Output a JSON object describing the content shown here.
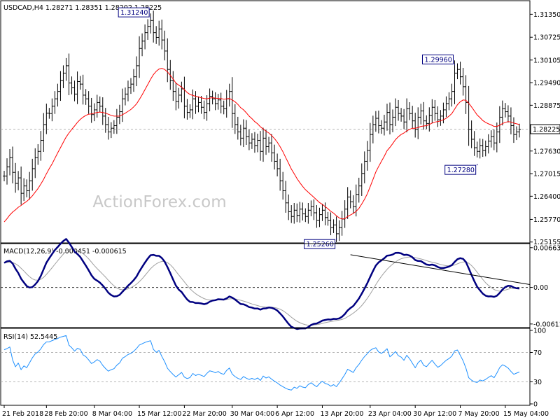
{
  "chart_data": {
    "type": "ohlc",
    "symbol_header": "USDCAD,H4  1.28271 1.28351 1.28202 1.28225",
    "watermark": "ActionForex.com",
    "price_panel": {
      "ylim": [
        1.2515,
        1.317
      ],
      "ticks": [
        "1.31350",
        "1.30725",
        "1.30105",
        "1.29490",
        "1.28875",
        "1.28225",
        "1.27630",
        "1.27015",
        "1.26400",
        "1.25770",
        "1.25155"
      ],
      "last_price": "1.28225",
      "annotations": [
        {
          "label": "1.31240",
          "bar": 52,
          "value": 1.3124
        },
        {
          "label": "1.25260",
          "bar": 118,
          "value": 1.2526
        },
        {
          "label": "1.29960",
          "bar": 160,
          "value": 1.2996
        },
        {
          "label": "1.27280",
          "bar": 168,
          "value": 1.2728
        }
      ],
      "close": [
        1.2695,
        1.272,
        1.2745,
        1.2705,
        1.2675,
        1.269,
        1.2648,
        1.2668,
        1.2655,
        1.2682,
        1.2715,
        1.2745,
        1.2762,
        1.2792,
        1.2835,
        1.2866,
        1.2865,
        1.2885,
        1.2905,
        1.2925,
        1.2955,
        1.2975,
        1.2995,
        1.2948,
        1.2935,
        1.2918,
        1.2952,
        1.2945,
        1.2915,
        1.2905,
        1.2885,
        1.2862,
        1.2875,
        1.2895,
        1.2885,
        1.2858,
        1.2835,
        1.2815,
        1.2825,
        1.2832,
        1.2855,
        1.287,
        1.2905,
        1.2918,
        1.2935,
        1.2945,
        1.2965,
        1.2995,
        1.3042,
        1.3062,
        1.3085,
        1.3102,
        1.3118,
        1.3085,
        1.3072,
        1.3095,
        1.3065,
        1.3035,
        1.2985,
        1.2955,
        1.2925,
        1.2898,
        1.2915,
        1.2932,
        1.2885,
        1.2868,
        1.2875,
        1.2905,
        1.2885,
        1.2895,
        1.2882,
        1.2868,
        1.2892,
        1.2912,
        1.2905,
        1.2892,
        1.2902,
        1.2885,
        1.2878,
        1.2905,
        1.2925,
        1.2865,
        1.2835,
        1.2815,
        1.2798,
        1.2825,
        1.2802,
        1.2785,
        1.2795,
        1.2778,
        1.2792,
        1.2762,
        1.2798,
        1.2775,
        1.2785,
        1.2758,
        1.2735,
        1.2715,
        1.2682,
        1.2655,
        1.2622,
        1.2598,
        1.2585,
        1.2602,
        1.2588,
        1.2605,
        1.2592,
        1.2585,
        1.2602,
        1.2612,
        1.2595,
        1.2575,
        1.259,
        1.2602,
        1.2582,
        1.2575,
        1.2555,
        1.2562,
        1.2538,
        1.2555,
        1.2578,
        1.2605,
        1.2638,
        1.2625,
        1.2612,
        1.2645,
        1.2668,
        1.2702,
        1.2735,
        1.2765,
        1.2808,
        1.2835,
        1.2852,
        1.2832,
        1.2825,
        1.2842,
        1.2868,
        1.2835,
        1.2855,
        1.2882,
        1.2865,
        1.2858,
        1.2842,
        1.2878,
        1.2865,
        1.2845,
        1.2822,
        1.2855,
        1.2872,
        1.2845,
        1.2838,
        1.286,
        1.2882,
        1.2865,
        1.2848,
        1.2858,
        1.2875,
        1.2892,
        1.2905,
        1.2925,
        1.2975,
        1.2985,
        1.2965,
        1.2938,
        1.2895,
        1.2822,
        1.2795,
        1.2772,
        1.2762,
        1.2778,
        1.2765,
        1.2775,
        1.279,
        1.2802,
        1.2785,
        1.2815,
        1.2855,
        1.2878,
        1.287,
        1.2858,
        1.2832,
        1.2808,
        1.2815,
        1.2822
      ],
      "ma_close": [
        1.257,
        1.2579,
        1.2589,
        1.2597,
        1.2603,
        1.261,
        1.2615,
        1.2621,
        1.2626,
        1.2633,
        1.2641,
        1.2651,
        1.2661,
        1.2673,
        1.2686,
        1.2701,
        1.2715,
        1.2728,
        1.2743,
        1.2758,
        1.2772,
        1.2787,
        1.2801,
        1.2812,
        1.2822,
        1.2831,
        1.2841,
        1.2849,
        1.2855,
        1.286,
        1.2863,
        1.2864,
        1.2866,
        1.2868,
        1.2869,
        1.2868,
        1.2866,
        1.2863,
        1.286,
        1.2858,
        1.2858,
        1.2858,
        1.2862,
        1.2866,
        1.2871,
        1.2876,
        1.2883,
        1.2891,
        1.2903,
        1.2916,
        1.293,
        1.2944,
        1.2958,
        1.2971,
        1.298,
        1.2986,
        1.2988,
        1.2985,
        1.2978,
        1.2969,
        1.2959,
        1.2948,
        1.2942,
        1.2937,
        1.293,
        1.2922,
        1.2917,
        1.2914,
        1.2912,
        1.291,
        1.2908,
        1.2906,
        1.2905,
        1.2907,
        1.2908,
        1.2907,
        1.2906,
        1.2906,
        1.2904,
        1.2905,
        1.2906,
        1.2902,
        1.2897,
        1.289,
        1.2881,
        1.2875,
        1.2867,
        1.2858,
        1.2851,
        1.2843,
        1.2837,
        1.2829,
        1.2823,
        1.2817,
        1.2812,
        1.2805,
        1.2797,
        1.2787,
        1.2775,
        1.2761,
        1.2745,
        1.273,
        1.2714,
        1.2701,
        1.2688,
        1.2677,
        1.2667,
        1.2658,
        1.2651,
        1.2644,
        1.2637,
        1.263,
        1.2623,
        1.2618,
        1.2612,
        1.2606,
        1.2599,
        1.2594,
        1.2587,
        1.2581,
        1.2578,
        1.2579,
        1.2585,
        1.2589,
        1.2593,
        1.2599,
        1.2607,
        1.2619,
        1.2632,
        1.2647,
        1.2666,
        1.2686,
        1.2706,
        1.2721,
        1.2735,
        1.2749,
        1.2764,
        1.2773,
        1.2783,
        1.2794,
        1.2802,
        1.2808,
        1.2812,
        1.2818,
        1.2822,
        1.2825,
        1.2825,
        1.2827,
        1.283,
        1.2831,
        1.2832,
        1.2835,
        1.2839,
        1.2842,
        1.2843,
        1.2845,
        1.2848,
        1.2852,
        1.2858,
        1.2865,
        1.2877,
        1.2889,
        1.2897,
        1.2902,
        1.2901,
        1.2893,
        1.2883,
        1.2872,
        1.2861,
        1.2854,
        1.2846,
        1.2841,
        1.2837,
        1.2834,
        1.283,
        1.283,
        1.2833,
        1.2838,
        1.2841,
        1.2843,
        1.2842,
        1.2839,
        1.2837,
        1.2835
      ]
    },
    "macd_panel": {
      "label": "MACD(12,26,9) -0.000451 -0.000615",
      "ylim": [
        -0.0066,
        0.0072
      ],
      "ticks": [
        "0.006639",
        "0.00",
        "-0.006114"
      ],
      "main": [
        0.00409,
        0.00436,
        0.00444,
        0.00398,
        0.00312,
        0.0024,
        0.00146,
        0.00082,
        0.00022,
        -3e-05,
        4e-05,
        0.00047,
        0.00106,
        0.00191,
        0.00303,
        0.00413,
        0.00487,
        0.00558,
        0.00624,
        0.00674,
        0.00728,
        0.00775,
        0.00809,
        0.00748,
        0.00676,
        0.00598,
        0.00557,
        0.00509,
        0.00437,
        0.00364,
        0.00285,
        0.00202,
        0.00144,
        0.00113,
        0.0008,
        0.00031,
        -0.00025,
        -0.00089,
        -0.00128,
        -0.00151,
        -0.00147,
        -0.00124,
        -0.00074,
        -0.00024,
        0.00029,
        0.00072,
        0.00121,
        0.00181,
        0.00265,
        0.00342,
        0.00415,
        0.00481,
        0.00538,
        0.00543,
        0.00528,
        0.00527,
        0.00491,
        0.0043,
        0.00337,
        0.00237,
        0.00131,
        0.0003,
        -0.00038,
        -0.00077,
        -0.00142,
        -0.00203,
        -0.00241,
        -0.00245,
        -0.00261,
        -0.00261,
        -0.00268,
        -0.00281,
        -0.00268,
        -0.00239,
        -0.0022,
        -0.00213,
        -0.00198,
        -0.002,
        -0.00204,
        -0.00184,
        -0.00151,
        -0.00171,
        -0.00203,
        -0.0024,
        -0.00278,
        -0.00282,
        -0.00302,
        -0.00329,
        -0.00337,
        -0.00354,
        -0.00352,
        -0.00371,
        -0.00353,
        -0.0035,
        -0.00336,
        -0.00341,
        -0.00359,
        -0.00386,
        -0.00434,
        -0.00487,
        -0.00549,
        -0.00609,
        -0.00658,
        -0.00677,
        -0.00695,
        -0.00687,
        -0.00685,
        -0.00685,
        -0.00663,
        -0.00628,
        -0.00608,
        -0.00603,
        -0.00582,
        -0.00555,
        -0.00544,
        -0.00535,
        -0.00538,
        -0.00525,
        -0.00528,
        -0.00518,
        -0.0049,
        -0.00446,
        -0.00384,
        -0.00344,
        -0.0031,
        -0.00251,
        -0.00185,
        -0.00104,
        -0.00018,
        0.00072,
        0.00174,
        0.00275,
        0.00366,
        0.00418,
        0.00451,
        0.00487,
        0.0053,
        0.00535,
        0.00549,
        0.00576,
        0.00579,
        0.00568,
        0.00542,
        0.00546,
        0.00533,
        0.00503,
        0.00457,
        0.00442,
        0.00439,
        0.0041,
        0.00382,
        0.00374,
        0.00381,
        0.00368,
        0.00341,
        0.00325,
        0.00324,
        0.00334,
        0.00348,
        0.00371,
        0.00425,
        0.00471,
        0.00488,
        0.00477,
        0.00424,
        0.00319,
        0.00209,
        0.00102,
        0.0001,
        -0.00048,
        -0.00104,
        -0.00138,
        -0.00151,
        -0.00149,
        -0.00158,
        -0.0014,
        -0.00093,
        -0.00035,
        5e-05,
        0.00027,
        0.00023,
        -2e-05,
        -0.00015,
        -0.00018
      ],
      "signal": [
        0.0041,
        0.00415,
        0.00421,
        0.00416,
        0.00395,
        0.00364,
        0.0032,
        0.00273,
        0.00223,
        0.00178,
        0.00143,
        0.00124,
        0.0012,
        0.00134,
        0.00168,
        0.00217,
        0.00271,
        0.00328,
        0.00387,
        0.00444,
        0.00501,
        0.00556,
        0.00606,
        0.00635,
        0.00643,
        0.00634,
        0.00619,
        0.00597,
        0.00565,
        0.00525,
        0.00477,
        0.00422,
        0.00366,
        0.00315,
        0.00268,
        0.0022,
        0.00171,
        0.00119,
        0.0007,
        0.00025,
        -9e-05,
        -0.00032,
        -0.0004,
        -0.00037,
        -0.00024,
        -4e-05,
        0.00021,
        0.00053,
        0.00096,
        0.00145,
        0.00199,
        0.00256,
        0.00312,
        0.00358,
        0.00392,
        0.00419,
        0.00433,
        0.00433,
        0.00414,
        0.00378,
        0.00329,
        0.00269,
        0.00208,
        0.00151,
        0.00092,
        0.00033,
        -0.00022,
        -0.00067,
        -0.00106,
        -0.00137,
        -0.00163,
        -0.00187,
        -0.00203,
        -0.0021,
        -0.00212,
        -0.00212,
        -0.00209,
        -0.00207,
        -0.00207,
        -0.00202,
        -0.00192,
        -0.00188,
        -0.00191,
        -0.00201,
        -0.00216,
        -0.00229,
        -0.00243,
        -0.0026,
        -0.00276,
        -0.00291,
        -0.00303,
        -0.00317,
        -0.00324,
        -0.00329,
        -0.0033,
        -0.00332,
        -0.00337,
        -0.00347,
        -0.00364,
        -0.00389,
        -0.00421,
        -0.00458,
        -0.00498,
        -0.00534,
        -0.00566,
        -0.0059,
        -0.00609,
        -0.00624,
        -0.00632,
        -0.00631,
        -0.00627,
        -0.00622,
        -0.00614,
        -0.00602,
        -0.0059,
        -0.00579,
        -0.00571,
        -0.00562,
        -0.00555,
        -0.00547,
        -0.00536,
        -0.00518,
        -0.00491,
        -0.00462,
        -0.00431,
        -0.00395,
        -0.00353,
        -0.00303,
        -0.00246,
        -0.00182,
        -0.00111,
        -0.00034,
        0.00046,
        0.0012,
        0.00186,
        0.00246,
        0.00303,
        0.00349,
        0.00389,
        0.00426,
        0.00457,
        0.00479,
        0.00492,
        0.00502,
        0.00508,
        0.00507,
        0.00497,
        0.00486,
        0.00477,
        0.00463,
        0.00447,
        0.00432,
        0.00422,
        0.00411,
        0.00397,
        0.00383,
        0.00371,
        0.00363,
        0.00361,
        0.00363,
        0.00375,
        0.00394,
        0.00413,
        0.00425,
        0.00425,
        0.00404,
        0.00365,
        0.00313,
        0.00253,
        0.00192,
        0.00133,
        0.00078,
        0.00033,
        -3e-05,
        -0.00034,
        -0.00055,
        -0.00063,
        -0.00058,
        -0.00045,
        -0.0003,
        -0.0002,
        -0.00016,
        -0.00016,
        -0.00016
      ],
      "trendline": {
        "from": {
          "bar": 123,
          "value": 0.00546
        },
        "to": {
          "bar": 185,
          "value": 0.00098
        }
      }
    },
    "rsi_panel": {
      "label": "RSI(14) 52.5445",
      "ylim": [
        0,
        100
      ],
      "ticks": [
        "100",
        "70",
        "30",
        "0"
      ],
      "levels": [
        70,
        30
      ],
      "values": [
        73.7,
        75.2,
        77.4,
        59.6,
        50.5,
        55.6,
        46.6,
        51.7,
        49.2,
        55.9,
        62.7,
        67.9,
        70.7,
        74.9,
        80.8,
        84.3,
        84.3,
        86.1,
        87.6,
        89,
        90.9,
        91.9,
        93,
        79.9,
        76.4,
        71.8,
        75.6,
        74.2,
        66.8,
        64.4,
        59.8,
        55,
        57,
        60.3,
        58.2,
        52.4,
        48.1,
        44.6,
        46.6,
        47.9,
        52.7,
        55.7,
        62.2,
        64.4,
        67.2,
        68.7,
        71.6,
        75.3,
        80.1,
        81.8,
        83.6,
        84.9,
        86,
        74.2,
        70.2,
        72.8,
        64.6,
        57.5,
        48.4,
        44,
        40,
        36.6,
        39.8,
        42.9,
        36.5,
        34.5,
        35.8,
        41.4,
        38.6,
        40.4,
        38.9,
        37.2,
        41.5,
        45,
        44.1,
        42.3,
        44.1,
        41.4,
        40.3,
        45.4,
        48.9,
        40.5,
        37.1,
        34.9,
        33.2,
        37.2,
        35,
        33.2,
        34.8,
        33.1,
        35.3,
        31.9,
        37.9,
        35.2,
        36.8,
        33.6,
        30.9,
        28.6,
        25.6,
        23.4,
        21.2,
        19.6,
        18.8,
        22.8,
        21.1,
        24.7,
        22.9,
        22,
        26.4,
        28.8,
        25.9,
        23.3,
        27.6,
        31,
        27.7,
        26.7,
        24.1,
        26.2,
        23.4,
        28.6,
        34.1,
        40,
        47.1,
        45,
        42.8,
        49.2,
        53.7,
        59.5,
        64.5,
        68.4,
        72.7,
        75.1,
        76.4,
        70.7,
        68.8,
        71.5,
        75.1,
        64,
        67.3,
        71.2,
        65.6,
        63.6,
        59.2,
        66.2,
        61.5,
        55.2,
        49.1,
        56,
        59.5,
        52.3,
        50.7,
        55.1,
        59.3,
        54.2,
        49.8,
        52.1,
        55.8,
        59.3,
        61.7,
        65.1,
        72.2,
        73.3,
        66.2,
        58.6,
        48.7,
        35.6,
        32.3,
        30,
        29.1,
        32.5,
        31.2,
        33.3,
        36.1,
        38.4,
        35.6,
        41.9,
        49.3,
        53.2,
        51.4,
        48.8,
        44.2,
        40.3,
        41.9,
        43.4
      ]
    },
    "x_axis": {
      "labels": [
        {
          "text": "21 Feb 2018",
          "bar": 0
        },
        {
          "text": "28 Feb 20:00",
          "bar": 15
        },
        {
          "text": "8 Mar 04:00",
          "bar": 32
        },
        {
          "text": "15 Mar 12:00",
          "bar": 48
        },
        {
          "text": "22 Mar 20:00",
          "bar": 64
        },
        {
          "text": "30 Mar 04:00",
          "bar": 81
        },
        {
          "text": "6 Apr 12:00",
          "bar": 97
        },
        {
          "text": "13 Apr 20:00",
          "bar": 113
        },
        {
          "text": "23 Apr 04:00",
          "bar": 130
        },
        {
          "text": "30 Apr 12:00",
          "bar": 146
        },
        {
          "text": "7 May 20:00",
          "bar": 162
        },
        {
          "text": "15 May 04:00",
          "bar": 178
        }
      ]
    },
    "colors": {
      "bars": "#000000",
      "ma": "#ff0000",
      "macd_main": "#000080",
      "macd_signal": "#a0a0a0",
      "rsi": "#1e90ff",
      "annotation_text": "#000080",
      "watermark": "#c8c8c8"
    }
  }
}
